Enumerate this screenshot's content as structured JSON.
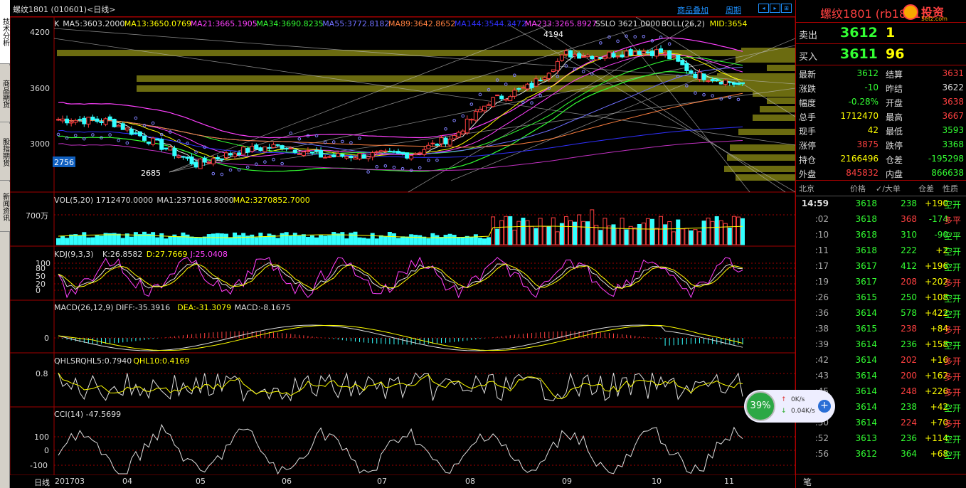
{
  "left_tabs": [
    "技术分析",
    "商品期货",
    "股指期货",
    "新闻资讯"
  ],
  "title": "螺纹1801 (010601)<日线>",
  "links": {
    "overlay": "商品叠加",
    "period": "周期"
  },
  "nav_buttons": [
    "◂",
    "▸",
    "⊞"
  ],
  "ma_legend": [
    {
      "text": "K",
      "color": "#dddddd"
    },
    {
      "text": "MA5:3603.2000",
      "color": "#dddddd"
    },
    {
      "text": "MA13:3650.0769",
      "color": "#ffff00"
    },
    {
      "text": "MA21:3665.1905",
      "color": "#ff40ff"
    },
    {
      "text": "MA34:3690.8235",
      "color": "#33ff33"
    },
    {
      "text": "MA55:3772.8182",
      "color": "#6f6fff"
    },
    {
      "text": "MA89:3642.8652",
      "color": "#ff8040"
    },
    {
      "text": "MA144:3544.3472",
      "color": "#3030ff"
    },
    {
      "text": "MA233:3265.8927",
      "color": "#ff40ff"
    },
    {
      "text": "SSLO 3621.0000",
      "color": "#dddddd"
    },
    {
      "text": "BOLL(26,2)",
      "color": "#dddddd"
    },
    {
      "text": "MID:3654",
      "color": "#ffff00"
    }
  ],
  "price_axis": [
    "4200",
    "3600",
    "3000"
  ],
  "price_marks": {
    "high_label": "4194",
    "low_label": "2685",
    "left_box": "2756"
  },
  "vol": {
    "legend": [
      {
        "text": "VOL(5,20) 1712470.0000",
        "color": "#dddddd"
      },
      {
        "text": "MA1:2371016.8000",
        "color": "#dddddd"
      },
      {
        "text": "MA2:3270852.7000",
        "color": "#ffff00"
      }
    ],
    "axis": "700万"
  },
  "kdj": {
    "legend": [
      {
        "text": "KDJ(9,3,3)",
        "color": "#dddddd"
      },
      {
        "text": "K:26.8582",
        "color": "#dddddd"
      },
      {
        "text": "D:27.7669",
        "color": "#ffff00"
      },
      {
        "text": "J:25.0408",
        "color": "#ff40ff"
      }
    ],
    "axis": [
      "100",
      "80",
      "50",
      "20",
      "0"
    ]
  },
  "macd": {
    "legend": [
      {
        "text": "MACD(26,12,9)",
        "color": "#dddddd"
      },
      {
        "text": "DIFF:-35.3916",
        "color": "#dddddd"
      },
      {
        "text": "DEA:-31.3079",
        "color": "#ffff00"
      },
      {
        "text": "MACD:-8.1675",
        "color": "#dddddd"
      }
    ],
    "axis": "0"
  },
  "qhlsr": {
    "legend": [
      {
        "text": "QHLSR",
        "color": "#dddddd"
      },
      {
        "text": "QHL5:0.7940",
        "color": "#dddddd"
      },
      {
        "text": "QHL10:0.4169",
        "color": "#ffff00"
      }
    ],
    "axis": "0.8"
  },
  "cci": {
    "legend": [
      {
        "text": "CCI(14) -47.5699",
        "color": "#dddddd"
      }
    ],
    "axis": [
      "100",
      "0",
      "-100"
    ]
  },
  "dates": {
    "period": "日线",
    "labels": [
      "201703",
      "04",
      "05",
      "06",
      "07",
      "08",
      "09",
      "10",
      "11"
    ]
  },
  "right": {
    "header": "螺纹1801 (rb1801)",
    "logo": "投资",
    "logo_sub": "5etz.com",
    "sell_label": "卖出",
    "sell_price": "3612",
    "sell_qty": "1",
    "buy_label": "买入",
    "buy_price": "3611",
    "buy_qty": "96",
    "stats": [
      [
        "最新",
        "3612",
        "结算",
        "3631"
      ],
      [
        "涨跌",
        "-10",
        "昨结",
        "3622"
      ],
      [
        "幅度",
        "-0.28%",
        "开盘",
        "3638"
      ],
      [
        "总手",
        "1712470",
        "最高",
        "3667"
      ],
      [
        "现手",
        "42",
        "最低",
        "3593"
      ],
      [
        "涨停",
        "3875",
        "跌停",
        "3368"
      ],
      [
        "持仓",
        "2166496",
        "仓差",
        "-195298"
      ],
      [
        "外盘",
        "845832",
        "内盘",
        "866638"
      ]
    ],
    "tick_header": [
      "北京",
      "价格",
      "✓/大单",
      "仓差",
      "性质"
    ],
    "ticks": [
      [
        "14:59",
        "3618",
        "238",
        "+190",
        "空开"
      ],
      [
        ":02",
        "3618",
        "368",
        "-174",
        "多平"
      ],
      [
        ":10",
        "3618",
        "310",
        "-90",
        "空平"
      ],
      [
        ":11",
        "3618",
        "222",
        "+2",
        "空开"
      ],
      [
        ":17",
        "3617",
        "412",
        "+196",
        "空开"
      ],
      [
        ":19",
        "3617",
        "208",
        "+202",
        "多开"
      ],
      [
        ":26",
        "3615",
        "250",
        "+108",
        "空开"
      ],
      [
        ":36",
        "3614",
        "578",
        "+422",
        "空开"
      ],
      [
        ":38",
        "3615",
        "238",
        "+84",
        "多开"
      ],
      [
        ":39",
        "3614",
        "236",
        "+158",
        "空开"
      ],
      [
        ":42",
        "3614",
        "202",
        "+16",
        "多开"
      ],
      [
        ":43",
        "3614",
        "200",
        "+162",
        "多开"
      ],
      [
        ":45",
        "3614",
        "248",
        "+226",
        "多开"
      ],
      [
        ":48",
        "3614",
        "238",
        "+42",
        "空开"
      ],
      [
        ":50",
        "3614",
        "224",
        "+70",
        "多开"
      ],
      [
        ":52",
        "3613",
        "236",
        "+114",
        "空开"
      ],
      [
        ":56",
        "3612",
        "364",
        "+68",
        "空开"
      ]
    ],
    "bottom_tab": "笔"
  },
  "badge": {
    "percent": "39%",
    "up": "0K/s",
    "down": "0.04K/s"
  }
}
